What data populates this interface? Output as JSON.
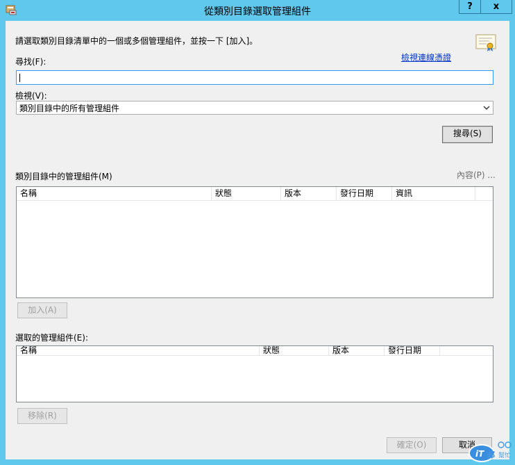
{
  "window": {
    "title": "從類別目錄選取管理組件",
    "help_label": "?",
    "close_label": "x"
  },
  "instructions": "請選取類別目錄清單中的一個或多個管理組件，並按一下 [加入]。",
  "view_credentials_link": "檢視連線憑證",
  "search": {
    "label": "尋找(F):",
    "value": ""
  },
  "view": {
    "label": "檢視(V):",
    "selected": "類別目錄中的所有管理組件"
  },
  "search_button": "搜尋(S)",
  "catalog": {
    "label": "類別目錄中的管理組件(M)",
    "properties_label": "內容(P) ...",
    "columns": [
      "名稱",
      "狀態",
      "版本",
      "發行日期",
      "資訊"
    ],
    "rows": []
  },
  "add_button": "加入(A)",
  "selected": {
    "label": "選取的管理組件(E):",
    "columns": [
      "名稱",
      "狀態",
      "版本",
      "發行日期"
    ],
    "rows": []
  },
  "remove_button": "移除(R)",
  "ok_button": "確定(O)",
  "cancel_button": "取消",
  "watermark_text": "iT邦幫忙",
  "colors": {
    "title_bar": "#60c8ec",
    "dialog_bg": "#f0f0f0",
    "link": "#0033cc",
    "focus_border": "#3399ff"
  }
}
